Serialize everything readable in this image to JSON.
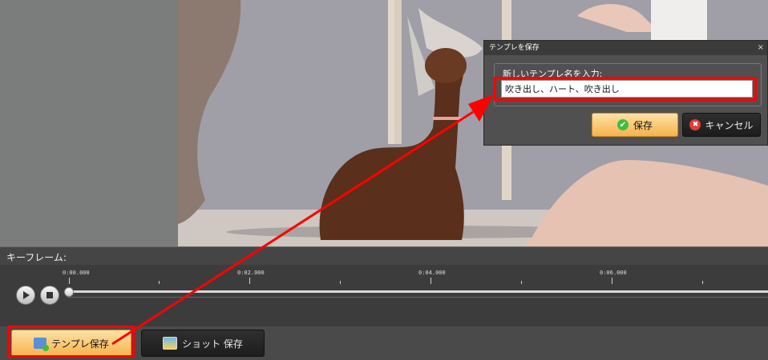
{
  "timeline": {
    "title": "キーフレーム:",
    "ticks": [
      "0:00.000",
      "0:02.000",
      "0:04.000",
      "0:06.000"
    ]
  },
  "footer": {
    "template_save_label": "テンプレ保存",
    "shot_save_label": "ショット 保存"
  },
  "dialog": {
    "title": "テンプレを保存",
    "close_glyph": "×",
    "prompt": "新しいテンプレ名を入力:",
    "input_value": "吹き出し、ハート、吹き出し",
    "save_label": "保存",
    "cancel_label": "キャンセル"
  },
  "icons": {
    "play": "play-icon",
    "stop": "stop-icon",
    "template": "template-icon",
    "shot": "photo-icon",
    "ok": "check-icon",
    "cancel": "cancel-icon"
  },
  "colors": {
    "highlight": "#ff0000",
    "accent_orange": "#f6b34b"
  }
}
